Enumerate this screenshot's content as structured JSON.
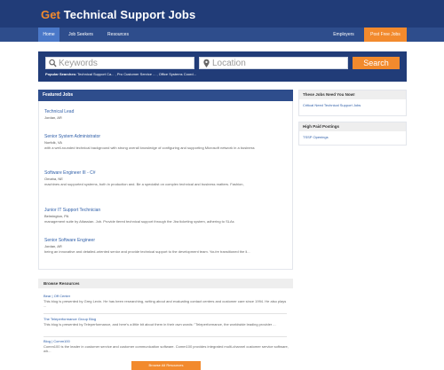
{
  "site": {
    "logo_accent": "Get",
    "logo_main": "Technical Support Jobs"
  },
  "nav": {
    "home": "Home",
    "job_seekers": "Job Seekers",
    "resources": "Resources",
    "employers": "Employers",
    "post_free": "Post Free Jobs"
  },
  "search": {
    "keywords_placeholder": "Keywords",
    "location_placeholder": "Location",
    "button": "Search",
    "popular_label": "Popular Searches:",
    "popular_items": "Technical Support Ca... , Pro Customer Service ... , Office Systems Coord..."
  },
  "featured": {
    "heading": "Featured Jobs",
    "jobs": [
      {
        "title": "Technical Lead",
        "location": "Jordan, AR",
        "desc": ""
      },
      {
        "title": "Senior System Administrator",
        "location": "Norfolk, VA",
        "desc": "with a well-rounded technical background with strong overall knowledge of configuring and supporting Microsoft network in a business"
      },
      {
        "title": "Software Engineer III - C#",
        "location": "Omaha, NE",
        "desc": "machines and supported systems, both in production and. Be a specialist on complex technical and business matters. Fashion,"
      },
      {
        "title": "Junior IT Support Technician",
        "location": "Belmington, PA",
        "desc": "management suite by Atlassian. Job. Provide tiered technical support through the Jira ticketing system, adhering to SLAs"
      },
      {
        "title": "Senior Software Engineer",
        "location": "Jordan, AR",
        "desc": "being an innovative and detailed-oriented senior and provide technical support to the development team. You're transitioned the li..."
      }
    ]
  },
  "resources": {
    "heading": "Browse Resources",
    "items": [
      {
        "title": "Bear | Off Center",
        "desc": "This blog is presented by Greg Levin. He has been researching, writing about and evaluating contact centers and customer care since 1994. He also plays ..."
      },
      {
        "title": "The Teleperformance Group Blog",
        "desc": "This blog is presented by Teleperformance, and here's a little bit about them in their own words: \"Teleperformance, the worldwide leading provider ..."
      },
      {
        "title": "Blog | Comm100",
        "desc": "Comm100 is the leader in customer service and customer communication software. Comm100 provides integrated multi-channel customer service software, wh..."
      }
    ],
    "more_button": "Browse All Resources"
  },
  "sidebar": {
    "need_heading": "These Jobs Need You Now!",
    "need_link": "Critical Need Technical Support Jobs",
    "highpaid_heading": "High Paid Postings",
    "highpaid_link": "TSSP Openings"
  },
  "colors": {
    "header_blue": "#213c78",
    "nav_blue": "#2e4d8c",
    "accent_orange": "#f28a2d",
    "link_blue": "#2e5ea8"
  }
}
